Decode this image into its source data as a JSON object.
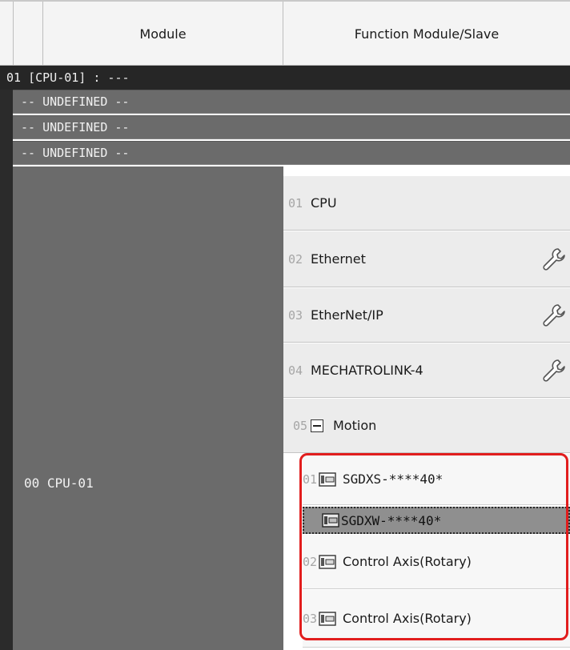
{
  "header": {
    "module_col": "Module",
    "function_col": "Function Module/Slave"
  },
  "cpu_row": {
    "label": "01  [CPU-01] : ---"
  },
  "undefined_rows": [
    "-- UNDEFINED --",
    "-- UNDEFINED --",
    "-- UNDEFINED --"
  ],
  "module": {
    "label": "00  CPU-01"
  },
  "functions": [
    {
      "num": "01",
      "label": "CPU",
      "has_settings": false
    },
    {
      "num": "02",
      "label": "Ethernet",
      "has_settings": true
    },
    {
      "num": "03",
      "label": "EtherNet/IP",
      "has_settings": true
    },
    {
      "num": "04",
      "label": "MECHATROLINK-4",
      "has_settings": true
    },
    {
      "num": "05",
      "label": "Motion",
      "has_settings": false
    }
  ],
  "motion_slaves": [
    {
      "num": "01",
      "label": "SGDXS-****40*"
    },
    {
      "num": "",
      "label": "SGDXW-****40*",
      "selected": true
    },
    {
      "num": "02",
      "label": "Control Axis(Rotary)"
    },
    {
      "num": "03",
      "label": "Control Axis(Rotary)"
    }
  ],
  "colors": {
    "highlight": "#e11d1d",
    "dark_row": "#262626",
    "undefined_row": "#6b6b6b"
  }
}
